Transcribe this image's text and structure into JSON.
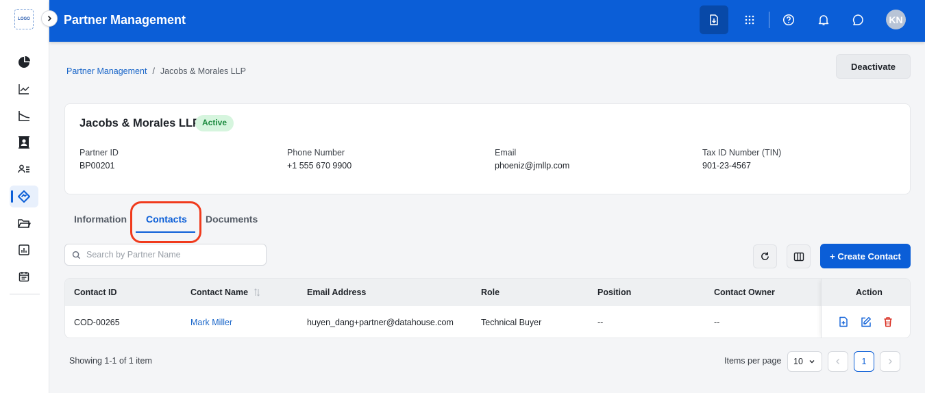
{
  "sidebar": {
    "logo": "LOGO",
    "items": [
      {
        "icon": "pie-chart-icon"
      },
      {
        "icon": "trend-line-icon"
      },
      {
        "icon": "area-chart-icon"
      },
      {
        "icon": "contact-card-icon"
      },
      {
        "icon": "user-list-icon"
      },
      {
        "icon": "partner-handshake-icon",
        "active": true
      },
      {
        "icon": "folder-icon"
      },
      {
        "icon": "report-icon"
      },
      {
        "icon": "calendar-icon"
      }
    ]
  },
  "header": {
    "title": "Partner Management",
    "avatar_initials": "KN",
    "icons": [
      "download-icon",
      "apps-grid-icon",
      "help-icon",
      "bell-icon",
      "chat-icon"
    ]
  },
  "breadcrumb": {
    "parent": "Partner Management",
    "separator": "/",
    "current": "Jacobs & Morales LLP"
  },
  "actions": {
    "deactivate_label": "Deactivate"
  },
  "partner": {
    "name": "Jacobs & Morales LLP",
    "status": "Active",
    "fields": [
      {
        "label": "Partner ID",
        "value": "BP00201"
      },
      {
        "label": "Phone Number",
        "value": "+1 555 670 9900"
      },
      {
        "label": "Email",
        "value": "phoeniz@jmllp.com"
      },
      {
        "label": "Tax ID Number (TIN)",
        "value": "901-23-4567"
      }
    ]
  },
  "tabs": [
    {
      "label": "Information"
    },
    {
      "label": "Contacts",
      "active": true
    },
    {
      "label": "Documents"
    }
  ],
  "search": {
    "placeholder": "Search by Partner Name"
  },
  "toolbar": {
    "create_label": "+ Create Contact"
  },
  "table": {
    "columns": [
      "Contact ID",
      "Contact Name",
      "Email Address",
      "Role",
      "Position",
      "Contact Owner",
      "Action"
    ],
    "rows": [
      {
        "contact_id": "COD-00265",
        "contact_name": "Mark Miller",
        "email": "huyen_dang+partner@datahouse.com",
        "role": "Technical Buyer",
        "position": "--",
        "owner": "--"
      }
    ]
  },
  "footer": {
    "showing": "Showing 1-1 of 1 item",
    "items_per_page_label": "Items per page",
    "items_per_page": "10",
    "current_page": "1"
  },
  "colors": {
    "primary": "#0b5ed7",
    "status_active_bg": "#d6f5de",
    "status_active_text": "#1c8a3f",
    "delete": "#d92d20",
    "highlight": "#f03a1c"
  }
}
